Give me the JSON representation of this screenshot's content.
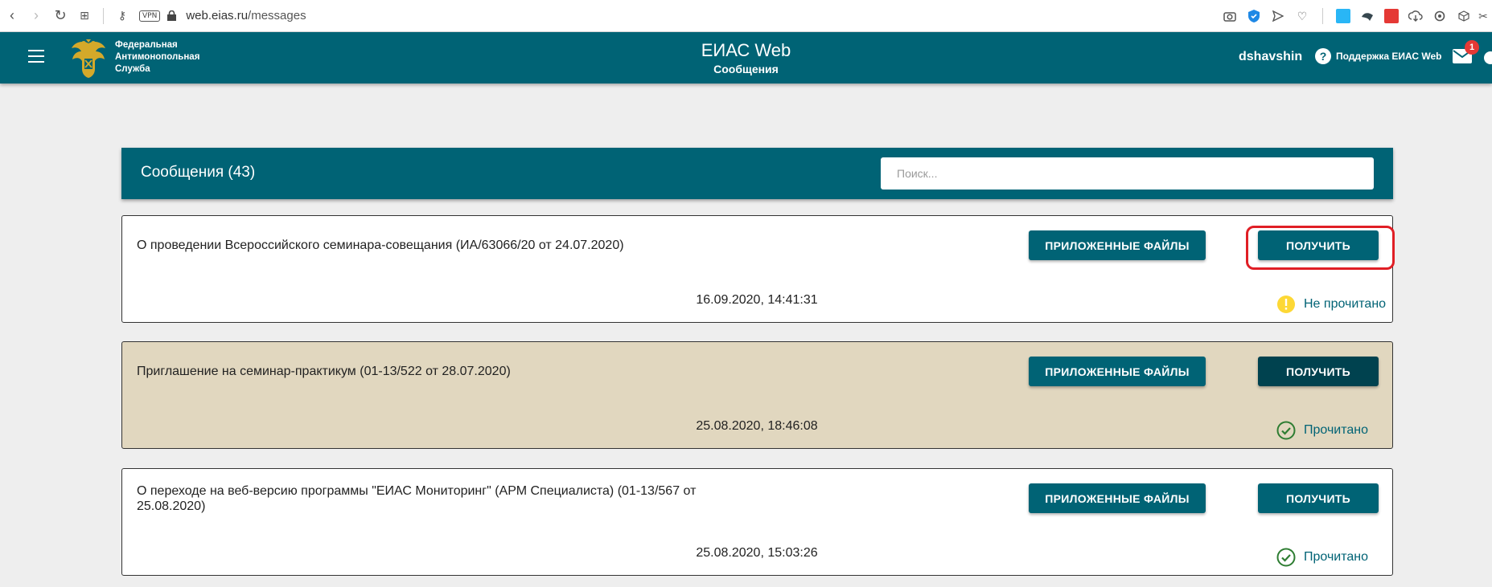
{
  "browser": {
    "url_host": "web.eias.ru",
    "url_path": "/messages",
    "vpn_label": "VPN"
  },
  "header": {
    "menu_icon": "hamburger-menu-icon",
    "org_line1": "Федеральная",
    "org_line2": "Антимонопольная",
    "org_line3": "Служба",
    "app_title": "ЕИАС Web",
    "app_subtitle": "Сообщения",
    "username": "dshavshin",
    "support_label": "Поддержка ЕИАС Web",
    "mail_badge": "1",
    "colors": {
      "bar": "#006375",
      "badge": "#e53935"
    }
  },
  "messages": {
    "title": "Сообщения (43)",
    "search_placeholder": "Поиск...",
    "files_button": "ПРИЛОЖЕННЫЕ ФАЙЛЫ",
    "get_button": "ПОЛУЧИТЬ",
    "items": [
      {
        "title": "О проведении Всероссийского семинара-совещания (ИА/63066/20 от 24.07.2020)",
        "date": "16.09.2020, 14:41:31",
        "status": "Не прочитано",
        "status_icon": "warning-icon"
      },
      {
        "title": "Приглашение на семинар-практикум (01-13/522 от 28.07.2020)",
        "date": "25.08.2020, 18:46:08",
        "status": "Прочитано",
        "status_icon": "check-circle-icon"
      },
      {
        "title": "О переходе на веб-версию программы \"ЕИАС Мониторинг\" (АРМ Специалиста) (01-13/567 от 25.08.2020)",
        "date": "25.08.2020, 15:03:26",
        "status": "Прочитано",
        "status_icon": "check-circle-icon"
      }
    ]
  }
}
